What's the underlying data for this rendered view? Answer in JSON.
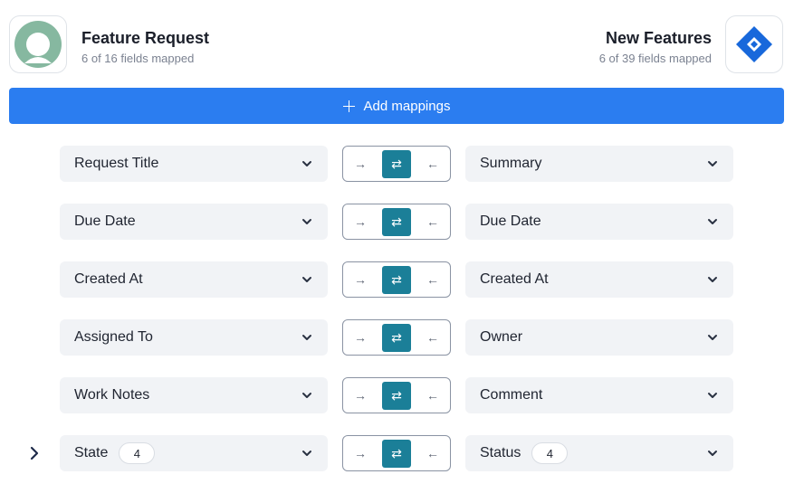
{
  "source": {
    "title": "Feature Request",
    "subtitle": "6 of 16 fields mapped",
    "icon": "source-app-logo-icon",
    "color": "#86b8a0"
  },
  "target": {
    "title": "New Features",
    "subtitle": "6 of 39 fields mapped",
    "icon": "jira-logo-icon",
    "color": "#1868db"
  },
  "add_button": {
    "label": "Add mappings",
    "color": "#2b7df0"
  },
  "direction_icons": {
    "left_to_right": "→",
    "both": "⇄",
    "right_to_left": "←",
    "active_color": "#1b7f98"
  },
  "mappings": [
    {
      "left": "Request Title",
      "right": "Summary"
    },
    {
      "left": "Due Date",
      "right": "Due Date"
    },
    {
      "left": "Created At",
      "right": "Created At"
    },
    {
      "left": "Assigned To",
      "right": "Owner"
    },
    {
      "left": "Work Notes",
      "right": "Comment"
    },
    {
      "left": "State",
      "left_badge": "4",
      "right": "Status",
      "right_badge": "4",
      "expandable": true
    }
  ]
}
